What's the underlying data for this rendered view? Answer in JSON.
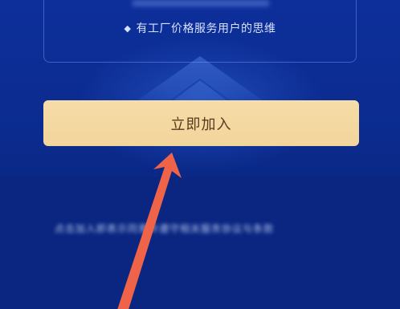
{
  "card": {
    "feature_text": "有工厂价格服务用户的思维",
    "diamond": "◆"
  },
  "join_button": {
    "label": "立即加入"
  },
  "footer": {
    "blurred_notice": "点击加入即表示同意并遵守相关服务协议与条款"
  },
  "colors": {
    "background": "#0b2b8e",
    "button": "#f3d8a0",
    "button_text": "#5a3a1c",
    "arrow": "#f0654a"
  },
  "icons": {
    "diamond": "diamond-bullet-icon",
    "arrow": "red-annotation-arrow-icon"
  }
}
